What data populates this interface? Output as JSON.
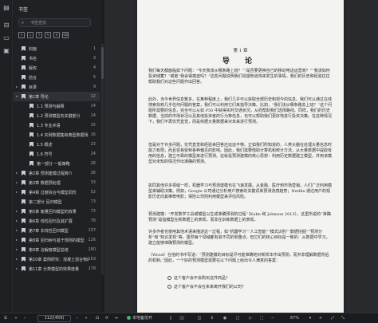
{
  "sidebar": {
    "title": "书签",
    "search_placeholder": "书签查找",
    "tools": [
      "+",
      "↓",
      "↑",
      "✎",
      "✕",
      "⌫"
    ]
  },
  "outline": [
    {
      "label": "封面",
      "page": "1",
      "level": 0,
      "expandable": false
    },
    {
      "label": "书名",
      "page": "3",
      "level": 0,
      "expandable": false
    },
    {
      "label": "版权",
      "page": "4",
      "level": 0,
      "expandable": false
    },
    {
      "label": "前言",
      "page": "5",
      "level": 0,
      "expandable": false
    },
    {
      "label": "目录",
      "page": "9",
      "level": 0,
      "expandable": true
    },
    {
      "label": "第1章  导论",
      "page": "12",
      "level": 0,
      "expandable": true,
      "active": true
    },
    {
      "label": "1.1  预测与解释",
      "page": "14",
      "level": 1,
      "expandable": false
    },
    {
      "label": "1.2  预测模型的关键部分",
      "page": "14",
      "level": 1,
      "expandable": false
    },
    {
      "label": "1.3  专业术语",
      "page": "15",
      "level": 1,
      "expandable": false
    },
    {
      "label": "1.4  实例数据集和典型数据场景",
      "page": "16",
      "level": 1,
      "expandable": false
    },
    {
      "label": "1.5  概述",
      "page": "23",
      "level": 1,
      "expandable": false
    },
    {
      "label": "1.6  符号",
      "page": "24",
      "level": 1,
      "expandable": false
    },
    {
      "label": "第一部分  一般策略",
      "page": "26",
      "level": 1,
      "expandable": false
    },
    {
      "label": "第2章  预测建模过程简介",
      "page": "26",
      "level": 0,
      "expandable": true
    },
    {
      "label": "第3章  数据预处理",
      "page": "33",
      "level": 0,
      "expandable": true
    },
    {
      "label": "第4章  过度拟合与模型调优",
      "page": "52",
      "level": 0,
      "expandable": true
    },
    {
      "label": "第二部分  回归模型",
      "page": "73",
      "level": 0,
      "expandable": false
    },
    {
      "label": "第5章  衡量回归模型的效果",
      "page": "73",
      "level": 0,
      "expandable": true
    },
    {
      "label": "第6章  线性回归及其扩展",
      "page": "78",
      "level": 0,
      "expandable": true
    },
    {
      "label": "第7章  非线性回归模型",
      "page": "107",
      "level": 0,
      "expandable": true
    },
    {
      "label": "第8章  回归树与基于规则的模型",
      "page": "126",
      "level": 0,
      "expandable": true
    },
    {
      "label": "第9章  溶解度模型总结",
      "page": "160",
      "level": 0,
      "expandable": true
    },
    {
      "label": "第10章  案例研究：混凝土混合物的抗压强度",
      "page": "163",
      "level": 0,
      "expandable": true
    },
    {
      "label": "第11章  分类模型的效果度量",
      "page": "178",
      "level": 0,
      "expandable": true
    }
  ],
  "document": {
    "chapter_label": "第 1 章",
    "chapter_title": "导 论",
    "paragraphs": [
      "    我们每天都面临如下问题：“今天我该从哪条路上班？”“是否要更换自己的移动电话运营商？”“我该如何投资储蓄？”或者“我会得癌症吗？”这些问题说明我们渴望知道将来发生的事情。我们的历史和经验往往帮助我们对这些问题作出回答。",
      "    此外，当今世界信息繁多，在某种程度上，我们几乎可以获取全部历史和现今的信息。我们可以通过在线搜索找到几乎任何问题的答案，我们可以利用它们来指导决策。比如，“我们该从哪条路去上班？”这个问题所需要的信息，完全可以从如 P50 中获得实时交通状况，从而帮助我们选择路线。同样，我们的历史数据、当前的市场状况以及其他投资者的行为等信息，也可以帮助我们更好地进行投资决策。在这种情况下，我们不再仅凭直觉，而是依据大量数据来对未来进行预测。",
      "    但是对于许多问题，仅凭直觉和经验来回答还远远不够。正如我们所知道的，人类大脑在处理大量信息时能力有限，而且容易受到各种偏见的影响。因此，我们需要借助计算机和统计方法，从大量数据中提取有用的信息，建立可靠的模型来进行预测。这就是预测建模的核心思想：利用历史数据建立模型，并用该模型对未知的情况作出准确的预测。",
      "    如同其他许多领域一样，机器学习与预测建模也在飞速发展。从金融、医疗到市场营销，人们广泛利用模型来辅助决策。例如，Google 公司通过分析用户搜索的关键词来预测流感趋势；Netflix 通过用户的观影历史向其推荐电影；保险公司则利用模型来评估风险。",
      "    预测建模：“开发数学工具或模型以生成准确预测的过程”（Kuhn 和 Johnson 2013）。这里所说的“准确预测”是指模型在新数据上的表现，而非在训练数据上的表现。",
      "    许多作者也使用其他术语来描述这一过程，如“机器学习”“人工智能”“模式识别”“数据挖掘”“预测分析”和“知识发现”等。虽然每个领域都有其不同的侧重点，但它们的核心目标是一致的：从数据中学习，建立能够准确预测的模型。",
      "    （Wood）在他的书中写道：“预测建模的目标是尽可能准确地对新样本作出预测，而并非理解数据背后的机制。”因此，一个好的预测模型需要在以下问题上给出令人满意的答案："
    ],
    "bullets": [
      "这个客户会不会购买这件商品？",
      "这个客户会不会在未来离开我们的公司？"
    ]
  },
  "status": {
    "page_indicator": "112/(456)",
    "backup_label": "本地备份开",
    "zoom": "67%"
  }
}
